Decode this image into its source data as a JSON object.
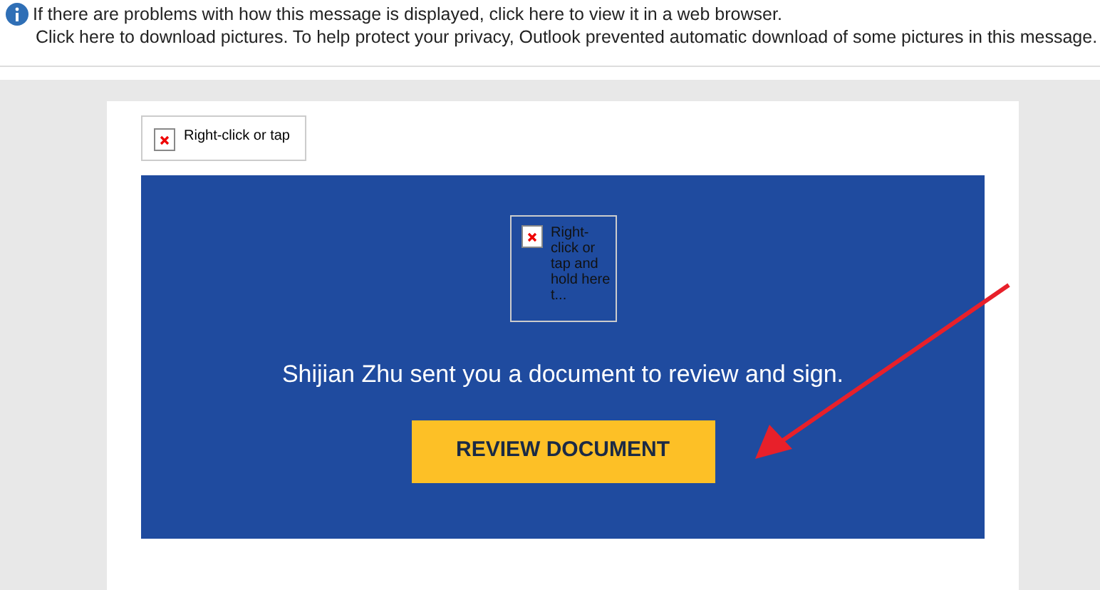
{
  "info_bar": {
    "message": "If there are problems with how this message is displayed, click here to view it in a web browser.",
    "download_notice": "Click here to download pictures. To help protect your privacy, Outlook prevented automatic download of some pictures in this message."
  },
  "email": {
    "header_image": {
      "alt": "Right-click or tap"
    },
    "banner": {
      "image": {
        "alt": "Right-click or tap and hold here t..."
      },
      "message": "Shijian Zhu sent you a document to review and sign.",
      "button": "REVIEW DOCUMENT"
    }
  }
}
